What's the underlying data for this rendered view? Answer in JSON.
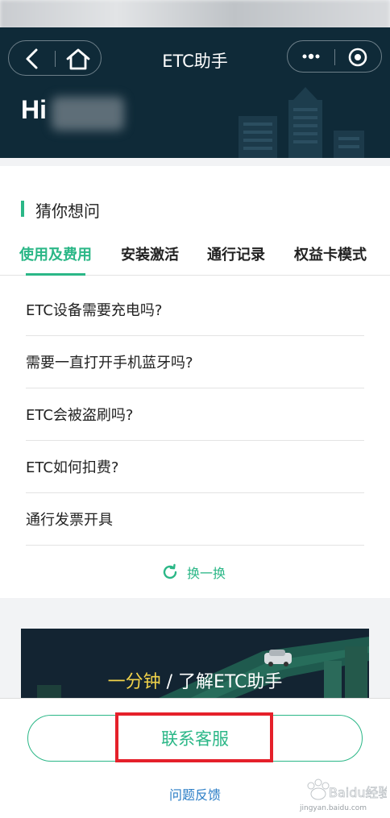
{
  "header": {
    "title": "ETC助手",
    "greeting": "Hi"
  },
  "icons": {
    "back": "chevron-left-icon",
    "home": "home-icon",
    "more": "more-dots-icon",
    "close": "target-circle-icon",
    "refresh": "refresh-icon"
  },
  "section": {
    "title": "猜你想问"
  },
  "tabs": [
    {
      "label": "使用及费用",
      "active": true
    },
    {
      "label": "安装激活",
      "active": false
    },
    {
      "label": "通行记录",
      "active": false
    },
    {
      "label": "权益卡模式",
      "active": false
    }
  ],
  "questions": [
    "ETC设备需要充电吗?",
    "需要一直打开手机蓝牙吗?",
    "ETC会被盗刷吗?",
    "ETC如何扣费?",
    "通行发票开具"
  ],
  "refresh_label": "换一换",
  "banner": {
    "highlight": "一分钟",
    "separator": " / ",
    "text": "了解ETC助手"
  },
  "bottom": {
    "contact_label": "联系客服",
    "feedback_label": "问题反馈"
  },
  "watermark": {
    "brand": "Baidu经验",
    "site": "jingyan.baidu.com"
  },
  "colors": {
    "accent": "#2bb787",
    "header_bg": "#0f2a38",
    "highlight_box": "#e5202a",
    "link": "#2a7dc6",
    "banner_yellow": "#f2d34a"
  }
}
